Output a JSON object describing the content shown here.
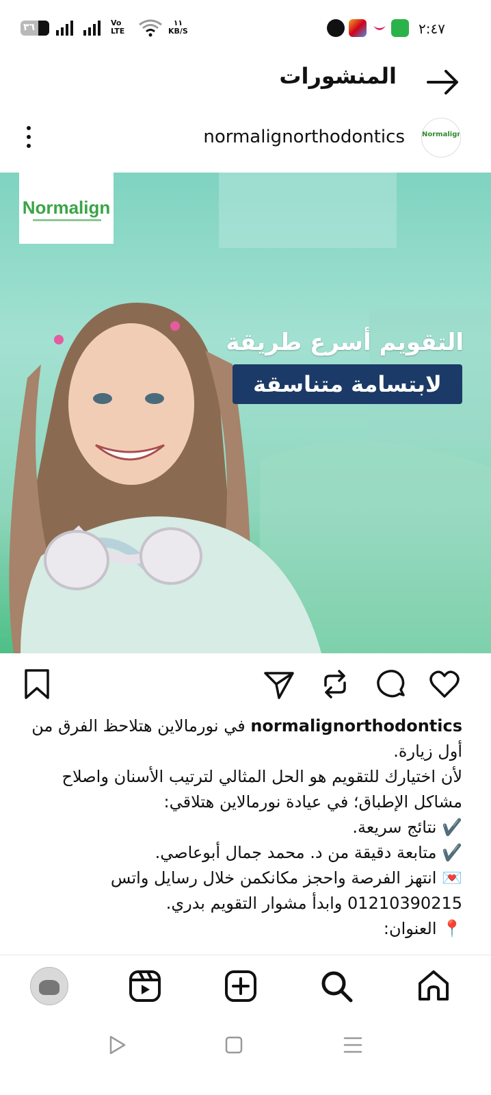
{
  "status_bar": {
    "battery": "٣٦",
    "network": [
      "Vo",
      "LTE"
    ],
    "speed": [
      "١١",
      "KB/S"
    ],
    "time": "٢:٤٧"
  },
  "header": {
    "title": "المنشورات",
    "back_icon": "arrow-right-icon"
  },
  "post": {
    "username": "normalignorthodontics",
    "avatar_text": "Normalign",
    "image": {
      "logo": "Normalign",
      "headline_line1": "التقويم أسرع طريقة",
      "headline_line2": "لابتسامة متناسقة"
    },
    "caption": {
      "username": "normalignorthodontics",
      "lines": [
        "في نورمالاين هتلاحظ الفرق من",
        "أول زيارة.",
        "لأن اختيارك للتقويم هو الحل المثالي لترتيب الأسنان واصلاح",
        "مشاكل الإطباق؛ في عيادة نورمالاين هتلاقي:",
        "✔️ نتائج سريعة.",
        "✔️ متابعة دقيقة من د. محمد جمال أبوعاصي.",
        "💌 انتهز الفرصة واحجز مكانكمن خلال رسايل واتس",
        "01210390215 وابدأ مشوار التقويم بدري.",
        "📍 العنوان:"
      ]
    },
    "actions": [
      "heart-icon",
      "comment-icon",
      "repost-icon",
      "send-icon",
      "bookmark-icon"
    ]
  },
  "bottom_nav": [
    "home-icon",
    "search-icon",
    "create-icon",
    "reels-icon",
    "profile-avatar"
  ],
  "system_nav": [
    "menu-icon",
    "home-square-icon",
    "back-triangle-icon"
  ],
  "colors": {
    "accent_green": "#3aa447",
    "banner_navy": "#1c3a67",
    "image_teal": "#8fd6bd"
  }
}
